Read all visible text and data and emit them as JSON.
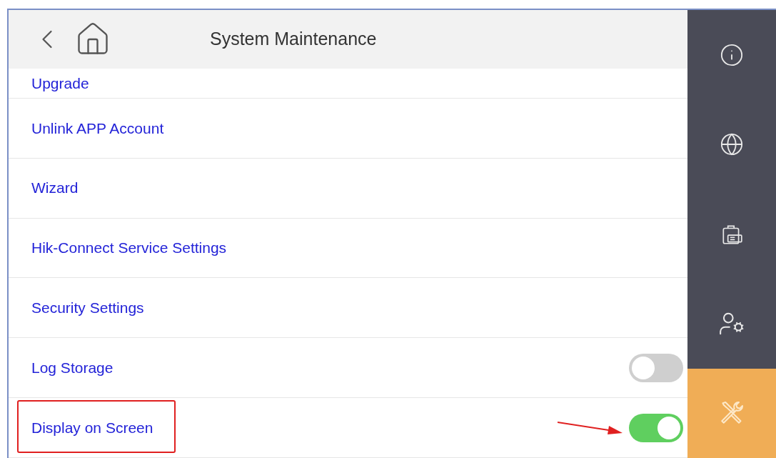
{
  "header": {
    "title": "System Maintenance"
  },
  "menu": [
    {
      "kind": "link",
      "label": "Upgrade"
    },
    {
      "kind": "link",
      "label": "Unlink APP Account"
    },
    {
      "kind": "link",
      "label": "Wizard"
    },
    {
      "kind": "link",
      "label": "Hik-Connect Service Settings"
    },
    {
      "kind": "link",
      "label": "Security Settings"
    },
    {
      "kind": "toggle",
      "label": "Log Storage",
      "on": false
    },
    {
      "kind": "toggle",
      "label": "Display on Screen",
      "on": true,
      "highlighted": true
    }
  ],
  "sidebar": {
    "items": [
      {
        "kind": "info",
        "selected": false
      },
      {
        "kind": "network",
        "selected": false
      },
      {
        "kind": "device",
        "selected": false
      },
      {
        "kind": "user",
        "selected": false
      },
      {
        "kind": "maintenance",
        "selected": true
      }
    ]
  }
}
